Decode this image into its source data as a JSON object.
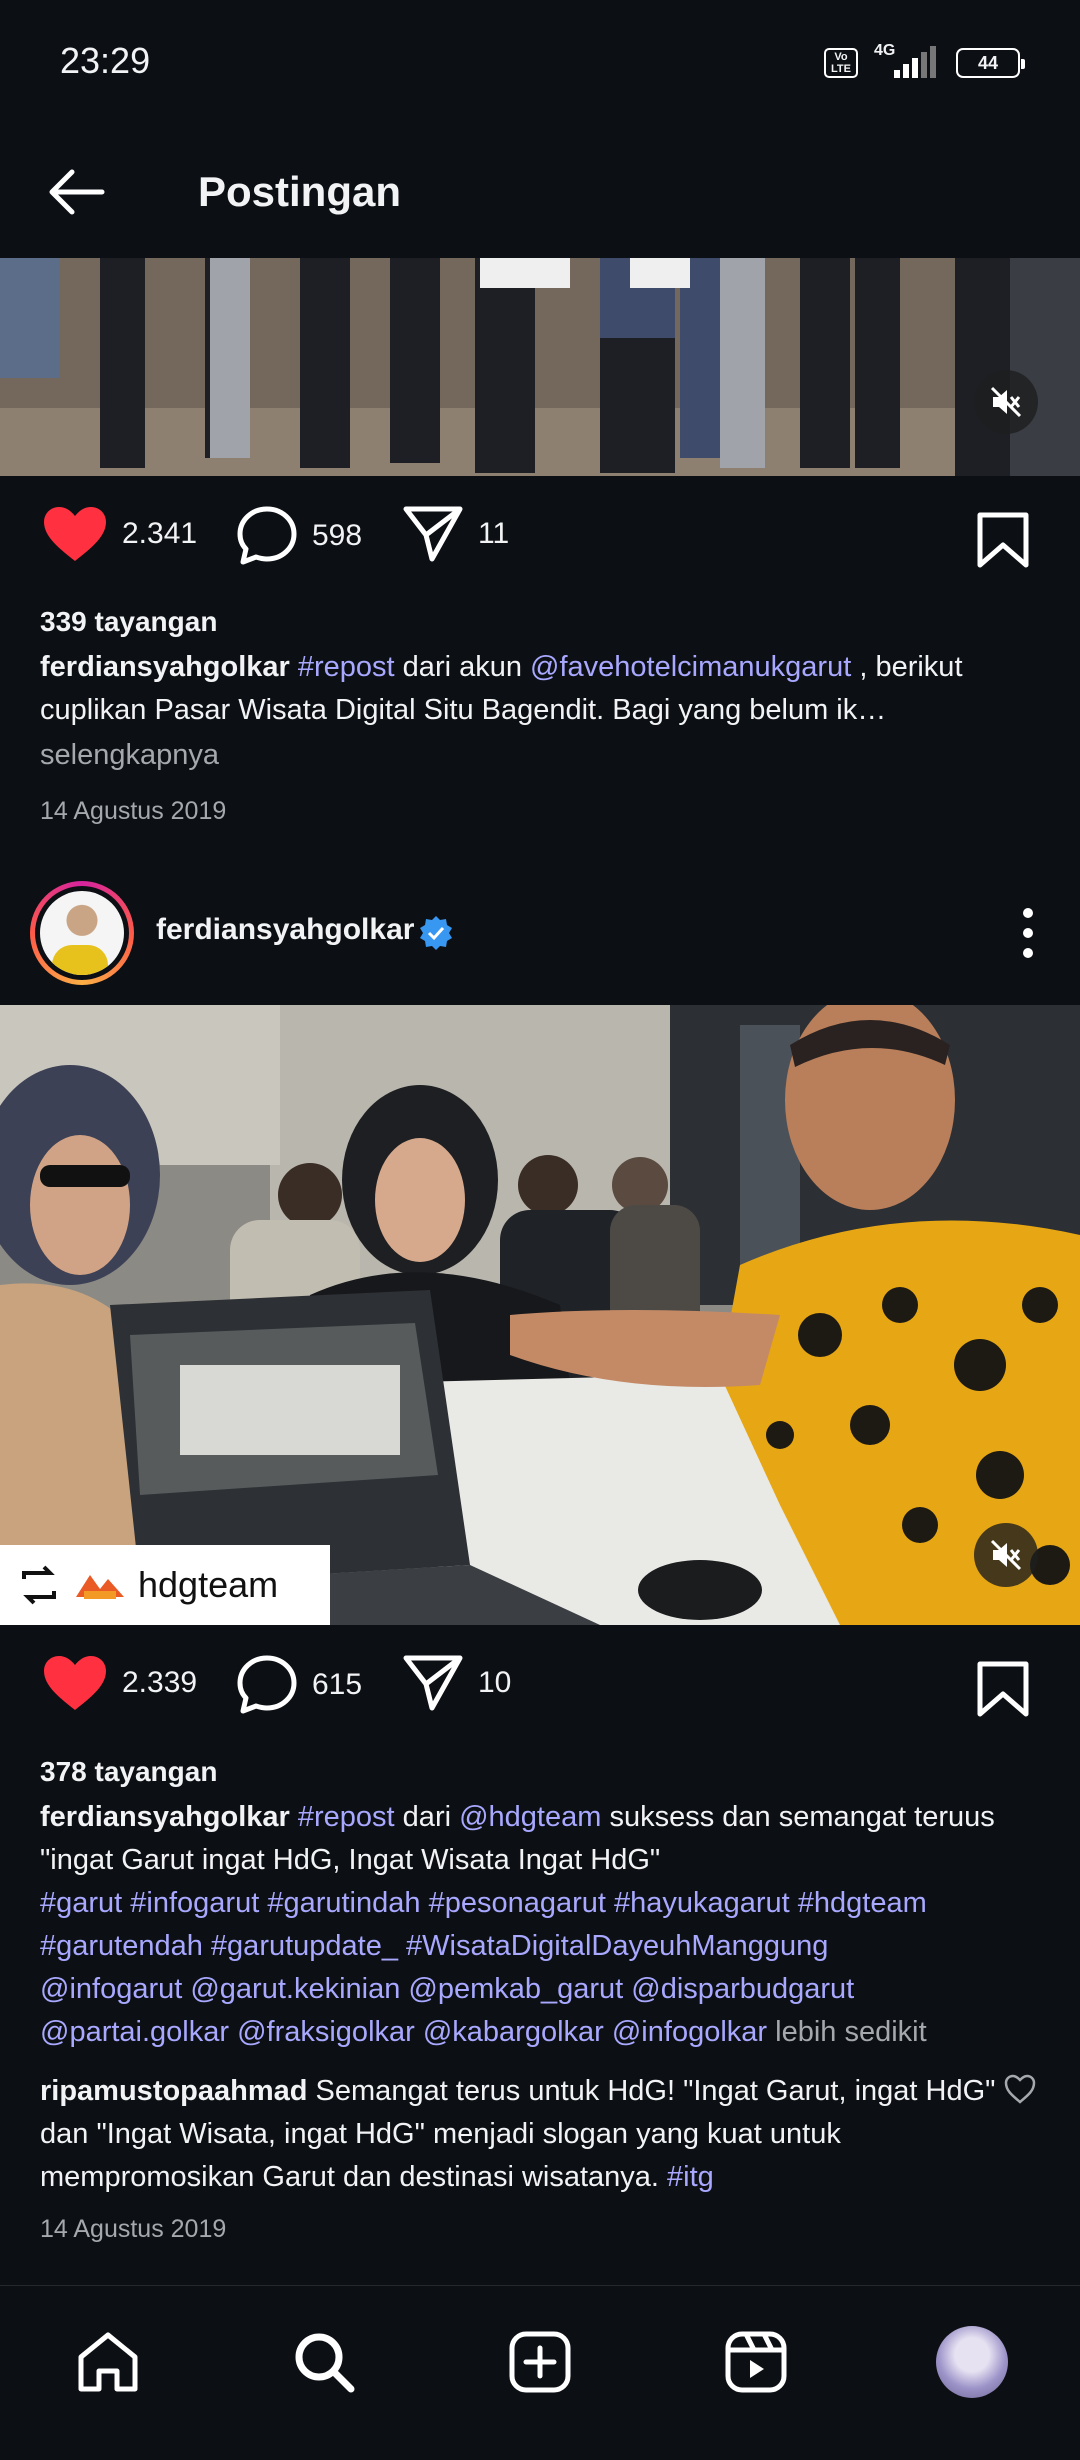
{
  "status": {
    "time": "23:29",
    "network": "4G",
    "volte": "Vo LTE",
    "battery": "44"
  },
  "header": {
    "title": "Postingan"
  },
  "post1": {
    "likes": "2.341",
    "comments": "598",
    "shares": "11",
    "views": "339 tayangan",
    "caption": {
      "user": "ferdiansyahgolkar",
      "tag1": "#repost",
      "text1": " dari akun ",
      "mention": "@favehotelcimanukgarut",
      "text2": " , berikut cuplikan Pasar Wisata Digital Situ Bagendit. Bagi yang belum ik…"
    },
    "more": "selengkapnya",
    "date": "14 Agustus 2019"
  },
  "post2": {
    "username": "ferdiansyahgolkar",
    "repost_badge": "hdgteam",
    "likes": "2.339",
    "comments": "615",
    "shares": "10",
    "views": "378 tayangan",
    "caption": {
      "user": "ferdiansyahgolkar",
      "tag1": "#repost",
      "text1": " dari ",
      "mention": "@hdgteam",
      "text2": " suksess dan semangat teruus \"ingat Garut ingat HdG, Ingat Wisata Ingat HdG\"",
      "tags_line1": "#garut #infogarut #garutindah #pesonagarut  #hayukagarut #hdgteam",
      "tags_line2": "#garutendah #garutupdate_ #WisataDigitalDayeuhManggung",
      "mentions_line1": "@infogarut @garut.kekinian @pemkab_garut @disparbudgarut",
      "mentions_line2": "@partai.golkar @fraksigolkar @kabargolkar  @infogolkar",
      "less": " lebih sedikit"
    },
    "comment": {
      "user": "ripamustopaahmad",
      "text": " Semangat terus untuk HdG! \"Ingat Garut, ingat HdG\" dan \"Ingat Wisata, ingat HdG\" menjadi slogan yang kuat untuk mempromosikan Garut dan destinasi wisatanya. ",
      "tag": "#itg"
    },
    "date": "14 Agustus 2019"
  },
  "colors": {
    "background": "#0c0f14",
    "like": "#ff3040",
    "hashtag": "#a8a8ff",
    "verified": "#3897f0"
  },
  "icons": [
    "back-arrow-icon",
    "heart-icon",
    "comment-icon",
    "share-icon",
    "bookmark-icon",
    "mute-icon",
    "verified-icon",
    "more-options-icon",
    "repost-icon",
    "home-icon",
    "search-icon",
    "create-icon",
    "reels-icon",
    "profile-avatar"
  ]
}
